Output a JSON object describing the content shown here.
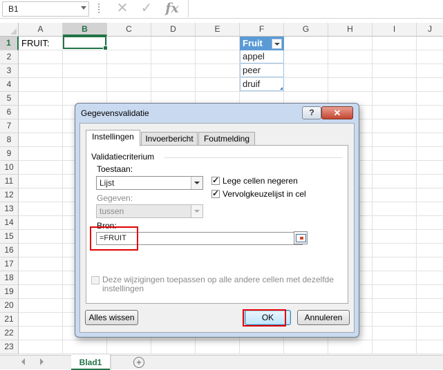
{
  "formula_bar": {
    "name_box": "B1",
    "cancel_glyph": "✕",
    "enter_glyph": "✓",
    "function_label": "fx",
    "formula": ""
  },
  "columns": [
    "A",
    "B",
    "C",
    "D",
    "E",
    "F",
    "G",
    "H",
    "I",
    "J"
  ],
  "selected_column": "B",
  "rows": [
    "1",
    "2",
    "3",
    "4",
    "5",
    "6",
    "7",
    "8",
    "9",
    "10",
    "11",
    "12",
    "13",
    "14",
    "15",
    "16",
    "17",
    "18",
    "19",
    "20",
    "21",
    "22",
    "23"
  ],
  "selected_row": "1",
  "cells": {
    "a1": "FRUIT:",
    "f1": "Fruit",
    "f2": "appel",
    "f3": "peer",
    "f4": "druif"
  },
  "sheet_tabs": {
    "active": "Blad1",
    "add_glyph": "+"
  },
  "dialog": {
    "title": "Gegevensvalidatie",
    "help_glyph": "?",
    "close_glyph": "✕",
    "tabs": [
      "Instellingen",
      "Invoerbericht",
      "Foutmelding"
    ],
    "active_tab": "Instellingen",
    "group_label": "Validatiecriterium",
    "allow_label": "Toestaan:",
    "allow_value": "Lijst",
    "data_label": "Gegeven:",
    "data_value": "tussen",
    "ignore_blank_label": "Lege cellen negeren",
    "ignore_blank_checked": true,
    "dropdown_label": "Vervolgkeuzelijst in cel",
    "dropdown_checked": true,
    "source_label": "Bron:",
    "source_value": "=FRUIT",
    "apply_all_label_line1": "Deze wijzigingen toepassen op alle andere cellen met dezelfde",
    "apply_all_label_line2": "instellingen",
    "apply_all_checked": false,
    "clear_all_button": "Alles wissen",
    "ok_button": "OK",
    "cancel_button": "Annuleren"
  },
  "colors": {
    "excel_green": "#217346",
    "table_header": "#5b9bd5",
    "highlight_red": "#e00000"
  }
}
